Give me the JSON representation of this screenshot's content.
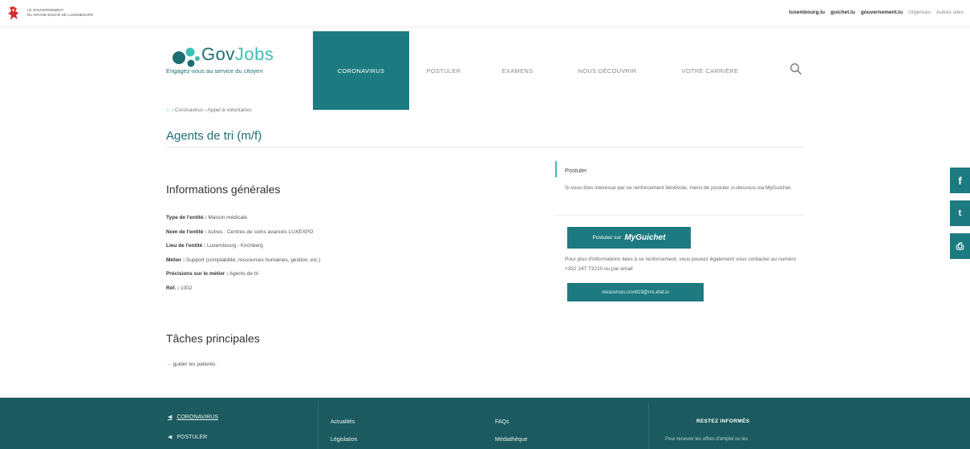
{
  "gov_bar": {
    "org_line1": "LE GOUVERNEMENT",
    "org_line2": "DU GRAND-DUCHÉ DE LUXEMBOURG",
    "links": [
      "luxembourg.lu",
      "guichet.lu",
      "gouvernement.lu",
      "Urgences",
      "Autres sites"
    ]
  },
  "logo": {
    "gov": "Gov",
    "jobs": "Jobs",
    "tagline": "Engagez-vous au service du citoyen"
  },
  "nav": {
    "items": [
      {
        "label": "CORONAVIRUS",
        "active": true
      },
      {
        "label": "POSTULER",
        "active": false
      },
      {
        "label": "EXAMENS",
        "active": false
      },
      {
        "label": "NOUS DÉCOUVRIR",
        "active": false
      },
      {
        "label": "VOTRE CARRIÈRE",
        "active": false
      }
    ],
    "search_icon": "search-icon"
  },
  "breadcrumb": {
    "home_icon": "home-icon",
    "text": "› Coronavirus › Appel à volontaires"
  },
  "page_title": "Agents de tri (m/f)",
  "info": {
    "heading": "Informations générales",
    "rows": [
      {
        "key": "Type de l'entité :",
        "value": " Maison médicale"
      },
      {
        "key": "Nom de l'entité :",
        "value": " Autres : Centres de soins avancés LUXEXPO"
      },
      {
        "key": "Lieu de l'entité :",
        "value": " Luxembourg - Kirchberg"
      },
      {
        "key": "Métier :",
        "value": " Support (comptabilité, ressources humaines, gestion, etc.)"
      },
      {
        "key": "Précisions sur le métier :",
        "value": " Agents de tri"
      },
      {
        "key": "Réf. :",
        "value": " 1002"
      }
    ]
  },
  "tasks": {
    "heading": "Tâches principales",
    "items": [
      "guider les patients."
    ]
  },
  "apply": {
    "title": "Postuler",
    "text": "Si vous êtes intéressé par ce renforcement bénévole, merci de postuler ci-dessous via MyGuichet.",
    "button_prefix": "Postulez sur",
    "button_brand": "MyGuichet",
    "contact_text": "Pour plus d'informations liées à ce renforcement, vous pouvez également vous contacter au numéro +352 247 73210 ou par email",
    "email_button": "ressources.covid19@ms.etat.lu"
  },
  "social": [
    {
      "icon": "facebook-icon",
      "glyph": "f"
    },
    {
      "icon": "twitter-icon",
      "glyph": "t"
    },
    {
      "icon": "print-icon",
      "glyph": "⎙"
    }
  ],
  "footer": {
    "col1": [
      "CORONAVIRUS",
      "POSTULER"
    ],
    "col2": [
      "Actualités",
      "Législation"
    ],
    "col3": [
      "FAQs",
      "Médiathèque"
    ],
    "newsletter_heading": "RESTEZ INFORMÉS",
    "newsletter_text": "Pour recevoir les offres d'emploi ou les"
  },
  "colors": {
    "primary": "#1d7a80",
    "accent": "#3dbfb2",
    "footer": "#1b5a5e"
  }
}
